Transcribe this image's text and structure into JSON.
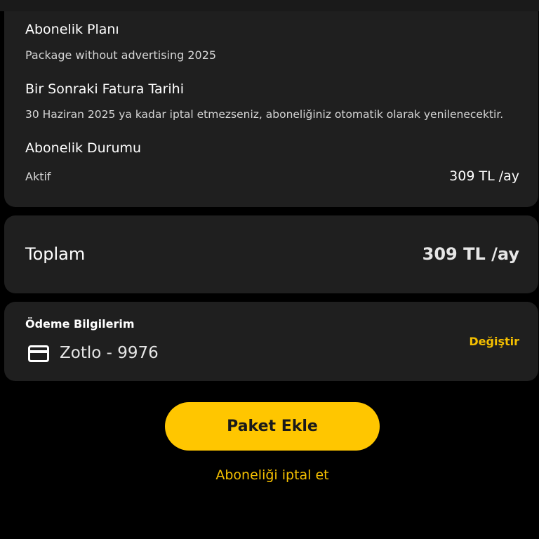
{
  "subscription": {
    "plan_label": "Abonelik Planı",
    "plan_value": "Package without advertising 2025",
    "next_billing_label": "Bir Sonraki Fatura Tarihi",
    "next_billing_value": "30 Haziran 2025 ya kadar iptal etmezseniz, aboneliğiniz otomatik olarak yenilenecektir.",
    "status_label": "Abonelik Durumu",
    "status_value": "Aktif",
    "price": "309 TL /ay"
  },
  "total": {
    "label": "Toplam",
    "value": "309 TL /ay"
  },
  "payment": {
    "title": "Ödeme Bilgilerim",
    "method": "Zotlo - 9976",
    "method_icon": "credit-card-icon",
    "change_label": "Değiştir"
  },
  "actions": {
    "add_package_label": "Paket Ekle",
    "cancel_label": "Aboneliği iptal et"
  },
  "colors": {
    "accent": "#ffc600",
    "link": "#f5c000",
    "card_bg": "#1f1f1f",
    "page_bg": "#000000"
  }
}
